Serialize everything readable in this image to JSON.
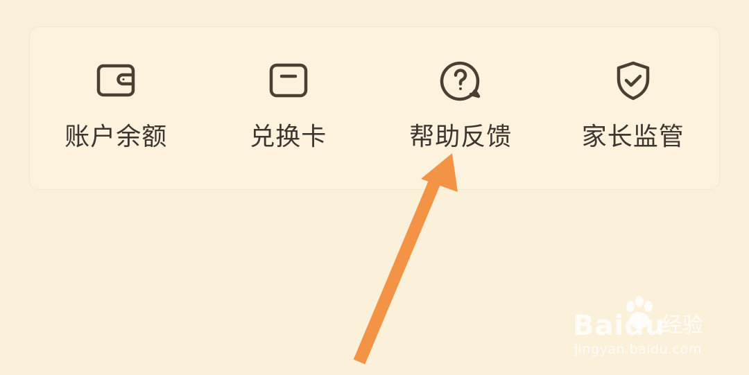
{
  "colors": {
    "background": "#FBF0D9",
    "card": "#FCF2DE",
    "icon_stroke": "#4A3F33",
    "label": "#3C3631",
    "arrow": "#F39345",
    "watermark": "#FFFFFF"
  },
  "menu": {
    "items": [
      {
        "label": "账户余额",
        "icon": "wallet-icon"
      },
      {
        "label": "兑换卡",
        "icon": "card-icon"
      },
      {
        "label": "帮助反馈",
        "icon": "help-chat-icon"
      },
      {
        "label": "家长监管",
        "icon": "shield-check-icon"
      }
    ]
  },
  "annotation": {
    "icon": "arrow-icon",
    "target": "帮助反馈"
  },
  "watermark": {
    "brand": "Baidu",
    "product": "经验",
    "url": "jingyan.baidu.com"
  }
}
